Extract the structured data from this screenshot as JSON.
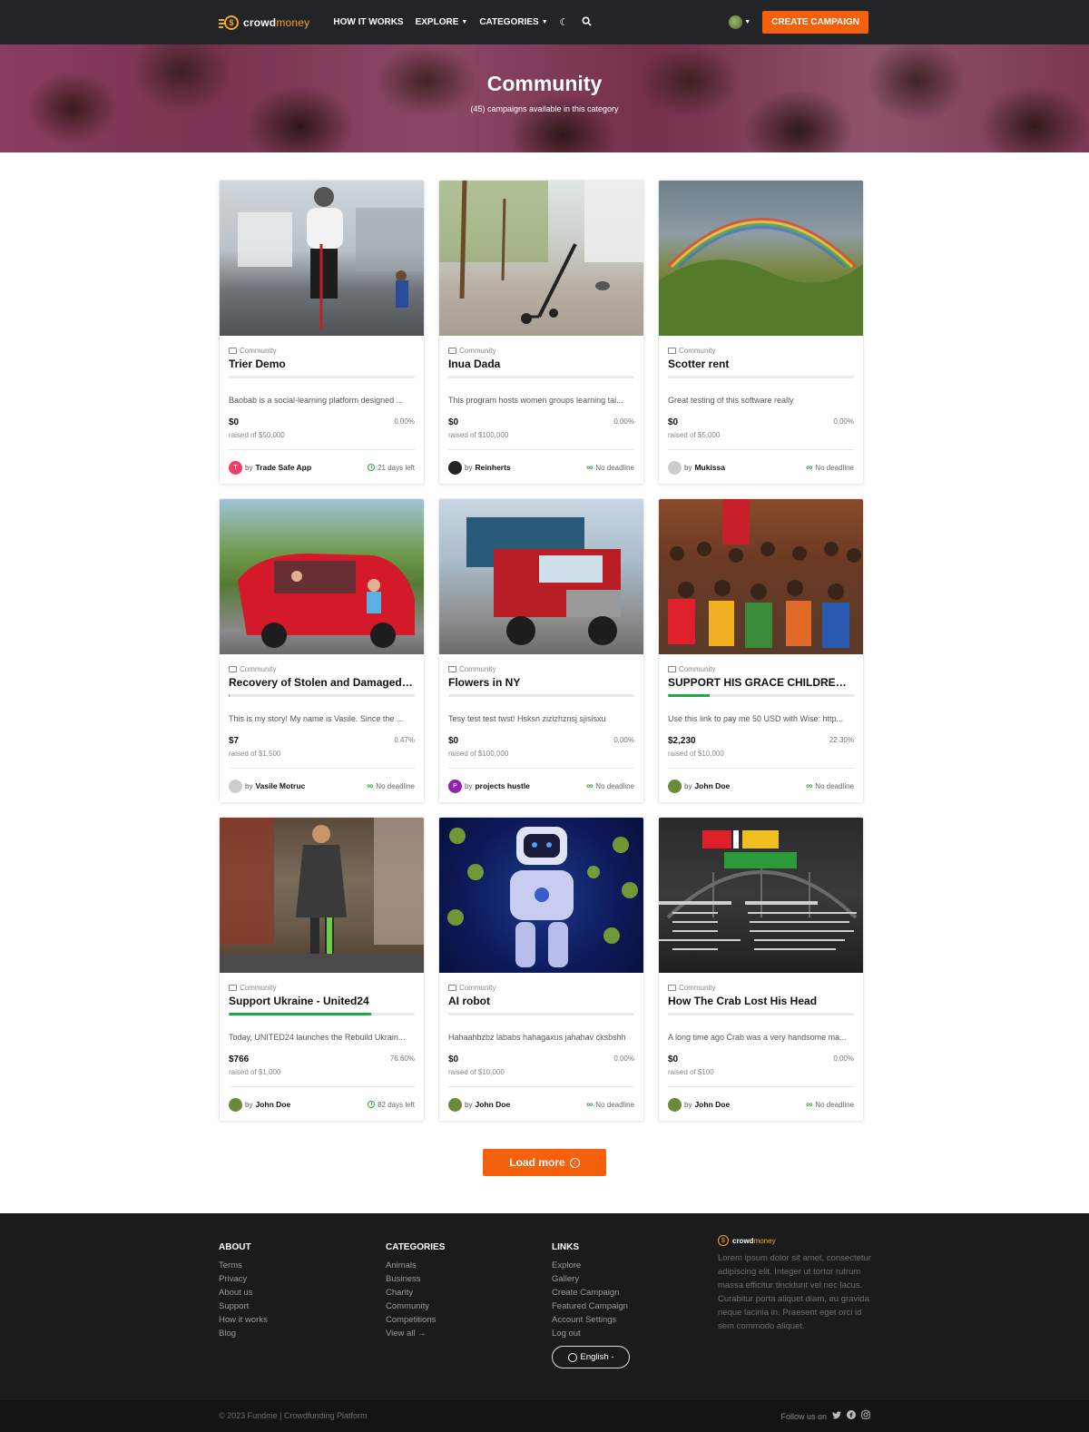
{
  "nav": {
    "logo_crowd": "crowd",
    "logo_money": "money",
    "links": [
      {
        "label": "HOW IT WORKS",
        "dropdown": false
      },
      {
        "label": "EXPLORE",
        "dropdown": true
      },
      {
        "label": "CATEGORIES",
        "dropdown": true
      }
    ],
    "create_label": "CREATE CAMPAIGN",
    "accent": "#f4600c"
  },
  "hero": {
    "title": "Community",
    "subtitle": "(45) campaigns available in this category"
  },
  "campaigns": [
    {
      "category": "Community",
      "title": "Trier Demo",
      "desc": "Baobab is a social-learning platform designed ...",
      "raised": "$0",
      "pct": "0.00%",
      "progress": 0,
      "goal": "raised of $50,000",
      "author": "Trade Safe App",
      "by": "by",
      "avatar_letter": "T",
      "avatar_color": "#e9416a",
      "deadline": "21 days left",
      "deadline_type": "clock"
    },
    {
      "category": "Community",
      "title": "Inua Dada",
      "desc": "This program hosts women groups learning tai...",
      "raised": "$0",
      "pct": "0.00%",
      "progress": 0,
      "goal": "raised of $100,000",
      "author": "Reinherts",
      "by": "by",
      "avatar_letter": "",
      "avatar_color": "#222222",
      "deadline": "No deadline",
      "deadline_type": "infinity"
    },
    {
      "category": "Community",
      "title": "Scotter rent",
      "desc": "Great testing of this software really",
      "raised": "$0",
      "pct": "0.00%",
      "progress": 0,
      "goal": "raised of $5,000",
      "author": "Mukissa",
      "by": "by",
      "avatar_letter": "",
      "avatar_color": "#cccccc",
      "deadline": "No deadline",
      "deadline_type": "infinity"
    },
    {
      "category": "Community",
      "title": "Recovery of Stolen and Damaged C...",
      "desc": "This is my story! My name is Vasile. Since the ...",
      "raised": "$7",
      "pct": "0.47%",
      "progress": 0.47,
      "goal": "raised of $1,500",
      "author": "Vasile Motruc",
      "by": "by",
      "avatar_letter": "",
      "avatar_color": "#cccccc",
      "deadline": "No deadline",
      "deadline_type": "infinity"
    },
    {
      "category": "Community",
      "title": "Flowers in NY",
      "desc": "Tesy test test twst! Hsksn zizizhznsj sjisisxu",
      "raised": "$0",
      "pct": "0.00%",
      "progress": 0,
      "goal": "raised of $100,000",
      "author": "projects hustle",
      "by": "by",
      "avatar_letter": "P",
      "avatar_color": "#8e24aa",
      "deadline": "No deadline",
      "deadline_type": "infinity"
    },
    {
      "category": "Community",
      "title": "SUPPORT HIS GRACE CHILDREN MI...",
      "desc": "Use this link to pay me 50 USD with Wise: http...",
      "raised": "$2,230",
      "pct": "22.30%",
      "progress": 22.3,
      "goal": "raised of $10,000",
      "author": "John Doe",
      "by": "by",
      "avatar_letter": "",
      "avatar_color": "#6b8a3a",
      "deadline": "No deadline",
      "deadline_type": "infinity"
    },
    {
      "category": "Community",
      "title": "Support Ukraine - United24",
      "desc": "Today, UNITED24 launches the Rebuild Ukrain...",
      "raised": "$766",
      "pct": "76.60%",
      "progress": 76.6,
      "goal": "raised of $1,000",
      "author": "John Doe",
      "by": "by",
      "avatar_letter": "",
      "avatar_color": "#6b8a3a",
      "deadline": "82 days left",
      "deadline_type": "clock"
    },
    {
      "category": "Community",
      "title": "AI robot",
      "desc": "Hahaahbzbz lababs hahagaxus jahahav cksbshh",
      "raised": "$0",
      "pct": "0.00%",
      "progress": 0,
      "goal": "raised of $10,000",
      "author": "John Doe",
      "by": "by",
      "avatar_letter": "",
      "avatar_color": "#6b8a3a",
      "deadline": "No deadline",
      "deadline_type": "infinity"
    },
    {
      "category": "Community",
      "title": "How The Crab Lost His Head",
      "desc": "A long time ago Crab was a very handsome ma...",
      "raised": "$0",
      "pct": "0.00%",
      "progress": 0,
      "goal": "raised of $100",
      "author": "John Doe",
      "by": "by",
      "avatar_letter": "",
      "avatar_color": "#6b8a3a",
      "deadline": "No deadline",
      "deadline_type": "infinity"
    }
  ],
  "load_more": "Load more",
  "footer": {
    "about": {
      "heading": "ABOUT",
      "links": [
        "Terms",
        "Privacy",
        "About us",
        "Support",
        "How it works",
        "Blog"
      ]
    },
    "categories": {
      "heading": "CATEGORIES",
      "links": [
        "Animals",
        "Business",
        "Charity",
        "Community",
        "Competitions",
        "View all →"
      ]
    },
    "links": {
      "heading": "LINKS",
      "links": [
        "Explore",
        "Gallery",
        "Create Campaign",
        "Featured Campaign",
        "Account Settings",
        "Log out"
      ]
    },
    "language": "English -",
    "logo_crowd": "crowd",
    "logo_money": "money",
    "about_text": "Lorem ipsum dolor sit amet, consectetur adipiscing elit. Integer ut tortor rutrum massa efficitur tincidunt vel nec lacus. Curabitur porta aliquet diam, eu gravida neque lacinia in. Praesent eget orci id sem commodo aliquet.",
    "copyright": "© 2023 Fundme | Crowdfunding Platform",
    "follow": "Follow us on"
  }
}
